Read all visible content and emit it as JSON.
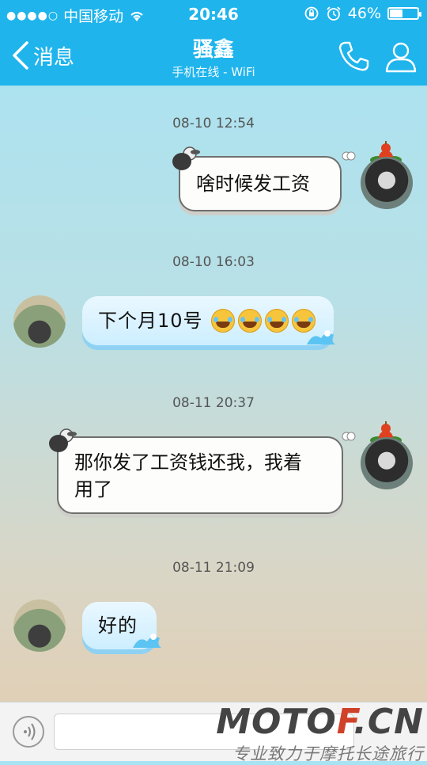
{
  "status_bar": {
    "carrier": "中国移动",
    "time": "20:46",
    "battery": "46%",
    "battery_level": 0.46
  },
  "nav": {
    "back_label": "消息",
    "title": "骚鑫",
    "subtitle": "手机在线 - WiFi"
  },
  "messages": [
    {
      "timestamp": "08-10 12:54",
      "side": "right",
      "text": "啥时候发工资"
    },
    {
      "timestamp": "08-10 16:03",
      "side": "left",
      "text": "下个月10号",
      "emoji_count": 4
    },
    {
      "timestamp": "08-11 20:37",
      "side": "right",
      "text_line1": "那你发了工资钱还我，我着",
      "text_line2": "用了"
    },
    {
      "timestamp": "08-11 21:09",
      "side": "left",
      "text": "好的"
    }
  ],
  "input_bar": {
    "placeholder": ""
  },
  "watermark": {
    "brand_pre": "MOTO",
    "brand_accent": "F",
    "brand_post": ".CN",
    "slogan": "专业致力于摩托长途旅行"
  },
  "colors": {
    "header": "#1fb4ec",
    "bubble_blue_shadow": "#8fd1f3",
    "watermark_accent": "#d0412a"
  }
}
